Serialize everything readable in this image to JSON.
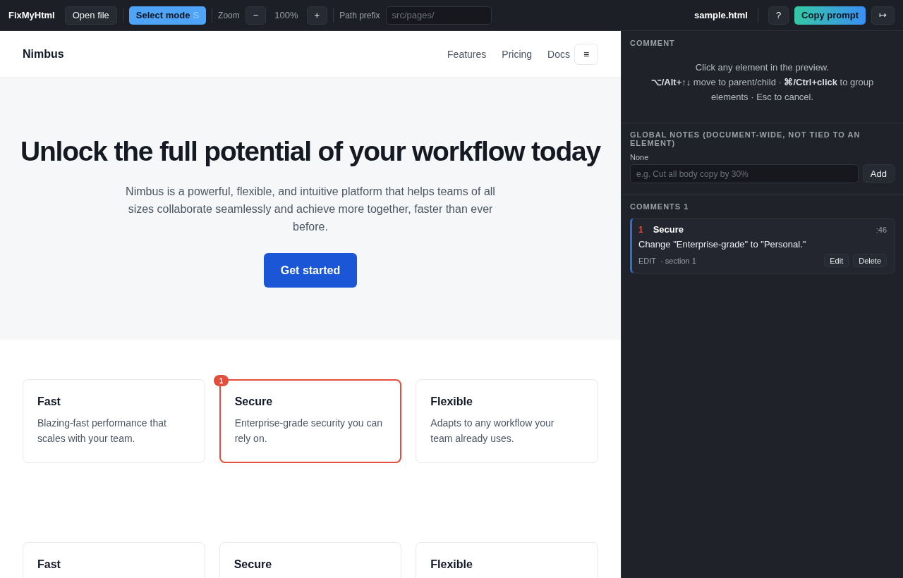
{
  "toolbar": {
    "app_name": "FixMyHtml",
    "open_button": "Open file",
    "mode_button": {
      "label": "Select mode",
      "shortcut": "S",
      "selected": true
    },
    "zoom_label": "Zoom",
    "zoom_out": "−",
    "zoom_value": "100%",
    "zoom_in": "+",
    "path_label": "Path prefix",
    "path_placeholder": "src/pages/",
    "file_name": "sample.html",
    "help_button": "?",
    "copy_button": "Copy prompt",
    "collapse_button": "↦"
  },
  "preview": {
    "brand": "Nimbus",
    "nav": [
      "Features",
      "Pricing",
      "Docs"
    ],
    "menu_button": "≡",
    "hero": {
      "title": "Unlock the full potential of your workflow today",
      "text": "Nimbus is a powerful, flexible, and intuitive platform that helps teams of all sizes collaborate seamlessly and achieve more together, faster than ever before.",
      "cta": "Get started"
    },
    "card_rows": [
      [
        {
          "title": "Fast",
          "text": "Blazing-fast performance that scales with your team.",
          "flagged": false
        },
        {
          "title": "Secure",
          "text": "Enterprise-grade security you can rely on.",
          "flagged": true,
          "badge": "1"
        },
        {
          "title": "Flexible",
          "text": "Adapts to any workflow your team already uses.",
          "flagged": false
        }
      ],
      [
        {
          "title": "Fast",
          "flagged": false
        },
        {
          "title": "Secure",
          "flagged": false
        },
        {
          "title": "Flexible",
          "flagged": false
        }
      ]
    ]
  },
  "sidebar": {
    "comment_heading": "COMMENT",
    "hint_lines": [
      "Click any element in the preview.",
      "**⌥/Alt+↑↓** move to parent/child · **⌘/Ctrl+click** to group elements · Esc to cancel."
    ],
    "notes_heading": "GLOBAL NOTES (DOCUMENT-WIDE, NOT TIED TO AN ELEMENT)",
    "notes_value": "None",
    "notes_placeholder": "e.g. Cut all body copy by 30%",
    "add_button": "Add",
    "comments_heading": "COMMENTS 1",
    "comments": [
      {
        "number": "1",
        "title": "Secure",
        "line": ":46",
        "text": "Change \"Enterprise-grade\" to \"Personal.\"",
        "type": "EDIT",
        "location": "· section 1",
        "edit_button": "Edit",
        "delete_button": "Delete"
      }
    ]
  }
}
